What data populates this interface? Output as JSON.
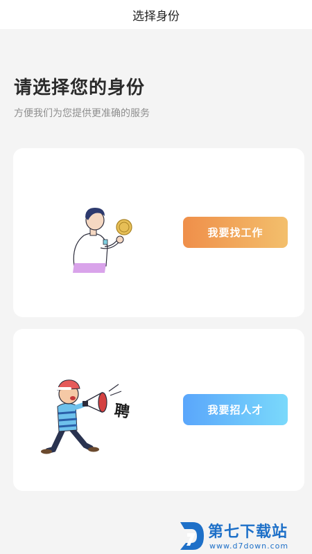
{
  "header": {
    "title": "选择身份"
  },
  "intro": {
    "title": "请选择您的身份",
    "subtitle": "方便我们为您提供更准确的服务"
  },
  "options": [
    {
      "button_label": "我要找工作",
      "illustration": "job-seeker-illustration",
      "accent": [
        "#ef8f4a",
        "#f3bf6c"
      ]
    },
    {
      "button_label": "我要招人才",
      "illustration": "recruiter-megaphone-illustration",
      "accent": [
        "#5aa6fb",
        "#7ad9fb"
      ],
      "illustration_text": "聘"
    }
  ],
  "watermark": {
    "title": "第七下载站",
    "url": "www.d7down.com"
  }
}
